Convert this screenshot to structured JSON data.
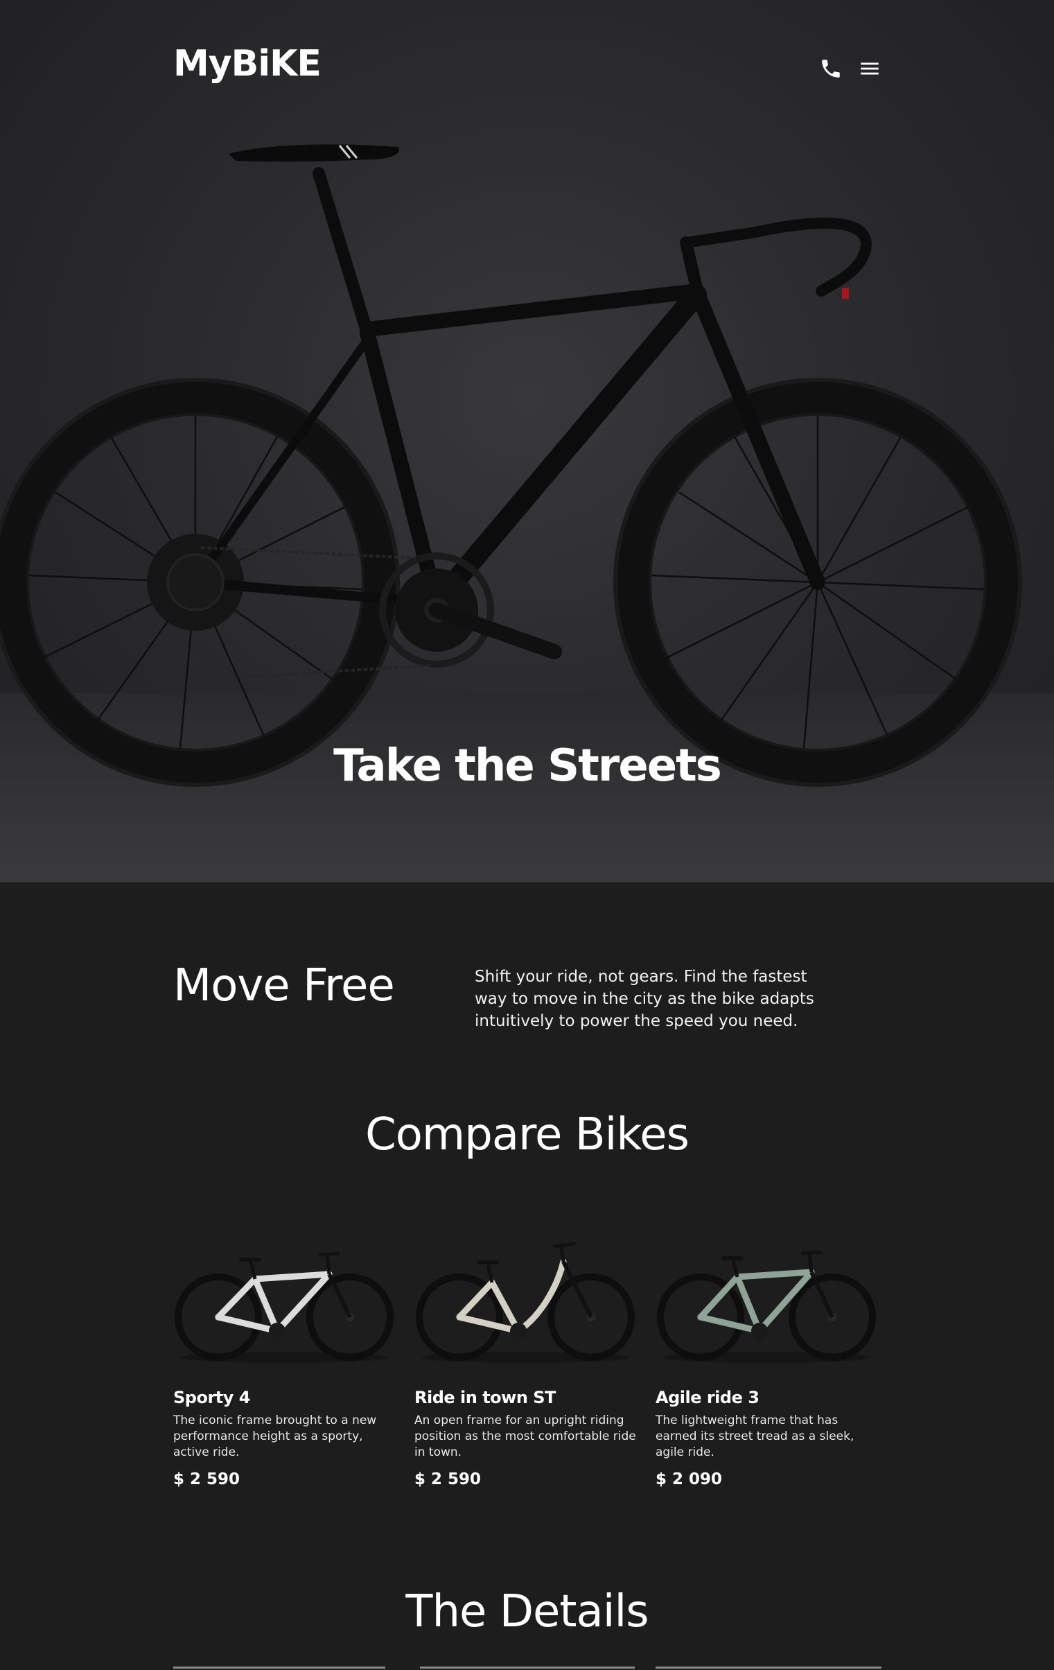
{
  "header": {
    "logo": "MyBiKE",
    "phone_icon": "phone-icon",
    "menu_icon": "hamburger-menu-icon"
  },
  "hero": {
    "title": "Take the Streets"
  },
  "intro": {
    "title": "Move Free",
    "text": "Shift your ride, not gears. Find the fastest way to move in the city as the bike adapts intuitively to power the speed you need."
  },
  "compare": {
    "title": "Compare Bikes",
    "bikes": [
      {
        "name": "Sporty 4",
        "description": "The iconic frame brought to a new performance height as a sporty, active ride.",
        "price": "$ 2 590",
        "frame_color": "#dcdcdc"
      },
      {
        "name": "Ride in town ST",
        "description": "An open frame for an upright riding position as the most comfortable ride in town.",
        "price": "$ 2 590",
        "frame_color": "#d4d0c6"
      },
      {
        "name": "Agile ride 3",
        "description": "The lightweight frame that has earned its street tread as a sleek, agile ride.",
        "price": "$ 2 090",
        "frame_color": "#8fa497"
      }
    ]
  },
  "details": {
    "title": "The Details"
  },
  "colors": {
    "background": "#1d1d1e",
    "hero_background": "#2b2b2d",
    "text": "#ffffff"
  }
}
